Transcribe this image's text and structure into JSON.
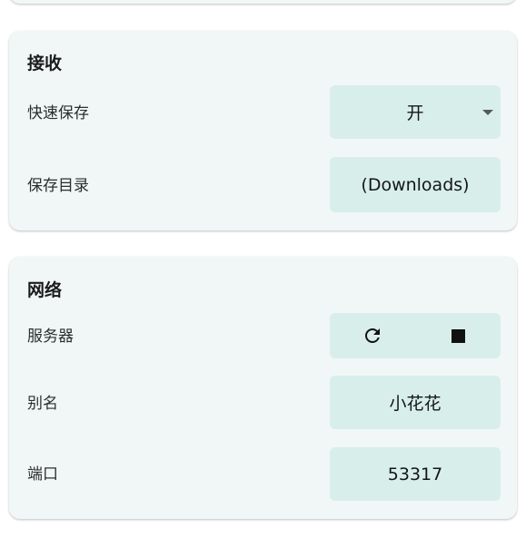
{
  "receive": {
    "title": "接收",
    "quick_save": {
      "label": "快速保存",
      "value": "开"
    },
    "save_dir": {
      "label": "保存目录",
      "value": "(Downloads)"
    }
  },
  "network": {
    "title": "网络",
    "server": {
      "label": "服务器",
      "icons": [
        "refresh-icon",
        "stop-icon"
      ]
    },
    "alias": {
      "label": "别名",
      "value": "小花花"
    },
    "port": {
      "label": "端口",
      "value": "53317"
    }
  },
  "colors": {
    "card_bg": "#f1f7f6",
    "control_bg": "#d8eeeb",
    "text": "#1a1c1c"
  }
}
